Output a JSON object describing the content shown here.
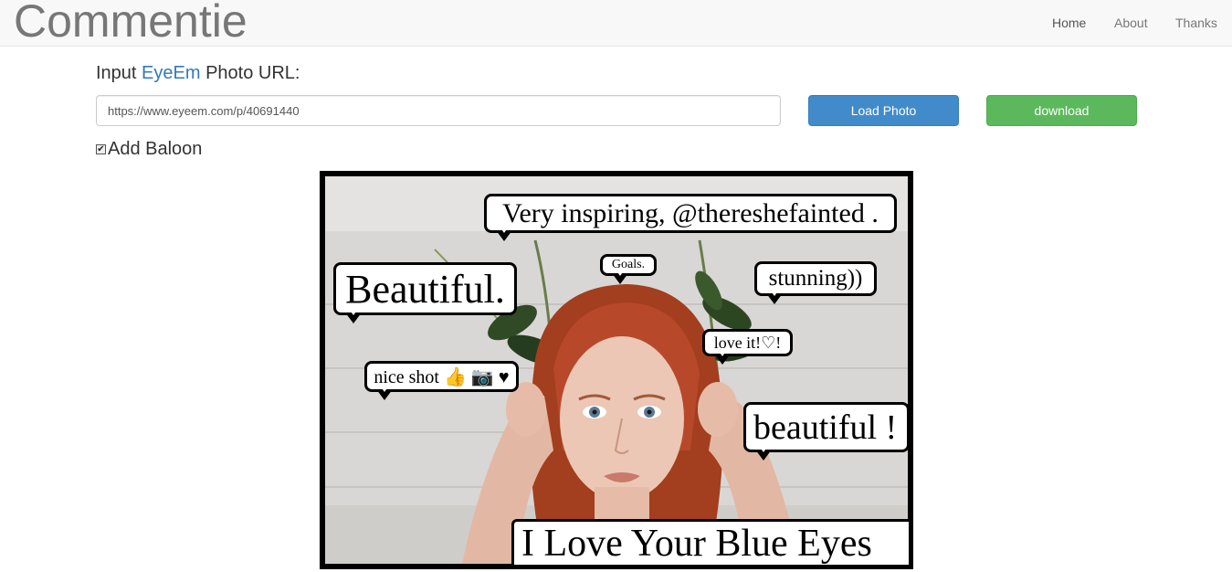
{
  "navbar": {
    "brand": "Commentie",
    "links": [
      "Home",
      "About",
      "Thanks"
    ]
  },
  "form": {
    "label_prefix": "Input ",
    "label_brand": "EyeEm",
    "label_suffix": " Photo URL:",
    "url_value": "https://www.eyeem.com/p/40691440",
    "load_button": "Load Photo",
    "download_button": "download",
    "checkbox_label": "Add Baloon",
    "checkbox_checked": true
  },
  "photo": {
    "balloons": [
      "Very inspiring, @thereshefainted .",
      "Goals.",
      "Beautiful.",
      "stunning))",
      "love it!♡!",
      "nice shot 👍 📷 ♥",
      "beautiful !"
    ],
    "caption": "I Love Your Blue Eyes"
  },
  "colors": {
    "primary": "#428bca",
    "success": "#5cb85c",
    "link": "#337ab7"
  }
}
